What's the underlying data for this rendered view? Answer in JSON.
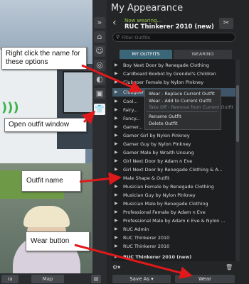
{
  "panel": {
    "title": "My Appearance",
    "now_wearing_label": "Now wearing...",
    "current_outfit": "RUC Thinkerer 2010 (new)",
    "filter_placeholder": "Filter Outfits",
    "tabs": [
      {
        "label": "MY OUTFITS",
        "active": true
      },
      {
        "label": "WEARING",
        "active": false
      }
    ],
    "outfits": [
      "Boy Next Door by Renegade Clothing",
      "Cardboard Boxbot by Grendel's Children",
      "Clubgoer Female by Nylon Pinkney",
      "Clubgoer Male by Nylon Pinkney",
      "Cool...",
      "Fairy...",
      "Fancy...",
      "Gamer...",
      "Gamer Girl by Nylon Pinkney",
      "Gamer Guy by Nylon Pinkney",
      "Gamer Male by Wraith Unsung",
      "Girl Next Door by Adam n Eve",
      "Girl Next Door by Renegade Clothing & A...",
      "Male Shape & Outfit",
      "Musician Female by Renegade Clothing",
      "Musician Guy by Nylon Pinkney",
      "Musician Male by Renegade Clothing",
      "Professional Female by Adam n Eve",
      "Professional Male by Adam n Eve & Nylon ...",
      "RUC Admin",
      "RUC Thinkerer 2010",
      "RUC Thinkerer 2010",
      "RUC Thinkerer 2010 (new)"
    ],
    "context_menu": [
      {
        "label": "Wear - Replace Current Outfit",
        "enabled": true
      },
      {
        "label": "Wear - Add to Current Outfit",
        "enabled": true
      },
      {
        "label": "Take Off - Remove from Current Outfit",
        "enabled": false
      },
      {
        "label": "Rename Outfit",
        "enabled": true
      },
      {
        "label": "Delete Outfit",
        "enabled": true
      }
    ],
    "save_as_label": "Save As",
    "wear_label": "Wear",
    "gear_icon": "gear-icon",
    "trash_icon": "trash-icon"
  },
  "bottom_bar": {
    "buttons": [
      "ra",
      "Map"
    ]
  },
  "annotations": {
    "right_click": "Right click the name for these options",
    "open_outfit": "Open outfit window",
    "outfit_name": "Outfit name",
    "wear_button": "Wear button",
    "arrow_color": "#e0191b"
  },
  "colors": {
    "accent_tab": "#3b6678",
    "now_wearing_green": "#95c54a",
    "selected_row": "#3e5667"
  }
}
